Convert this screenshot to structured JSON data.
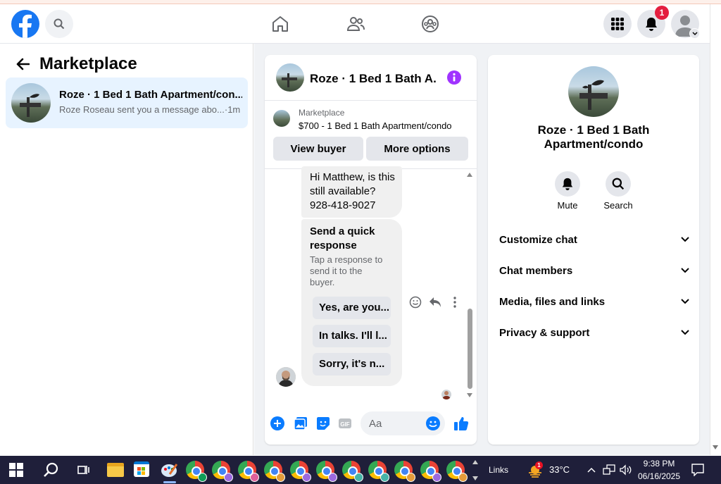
{
  "topbar": {
    "notifications_badge": "1",
    "accent": "#1877f2"
  },
  "left": {
    "title": "Marketplace",
    "conversation": {
      "title": "Roze · 1 Bed 1 Bath Apartment/con...",
      "preview": "Roze Roseau sent you a message abo...",
      "time": "·1m"
    }
  },
  "chat": {
    "header_title": "Roze · 1 Bed 1 Bath A...",
    "listing_source": "Marketplace",
    "listing_title": "$700 - 1 Bed 1 Bath Apartment/condo",
    "view_buyer": "View buyer",
    "more_options": "More options",
    "message": "Hi Matthew, is this still available? 928-418-9027",
    "quick_title": "Send a quick response",
    "quick_sub": "Tap a response to send it to the buyer.",
    "quick_options": [
      "Yes, are you...",
      "In talks. I'll l...",
      "Sorry, it's n..."
    ],
    "composer_placeholder": "Aa"
  },
  "info": {
    "name": "Roze · 1 Bed 1 Bath Apartment/condo",
    "mute_label": "Mute",
    "search_label": "Search",
    "sections": [
      "Customize chat",
      "Chat members",
      "Media, files and links",
      "Privacy & support"
    ]
  },
  "taskbar": {
    "links": "Links",
    "weather_badge": "1",
    "temperature": "33°C",
    "time": "9:38 PM",
    "date": "06/16/2025"
  }
}
